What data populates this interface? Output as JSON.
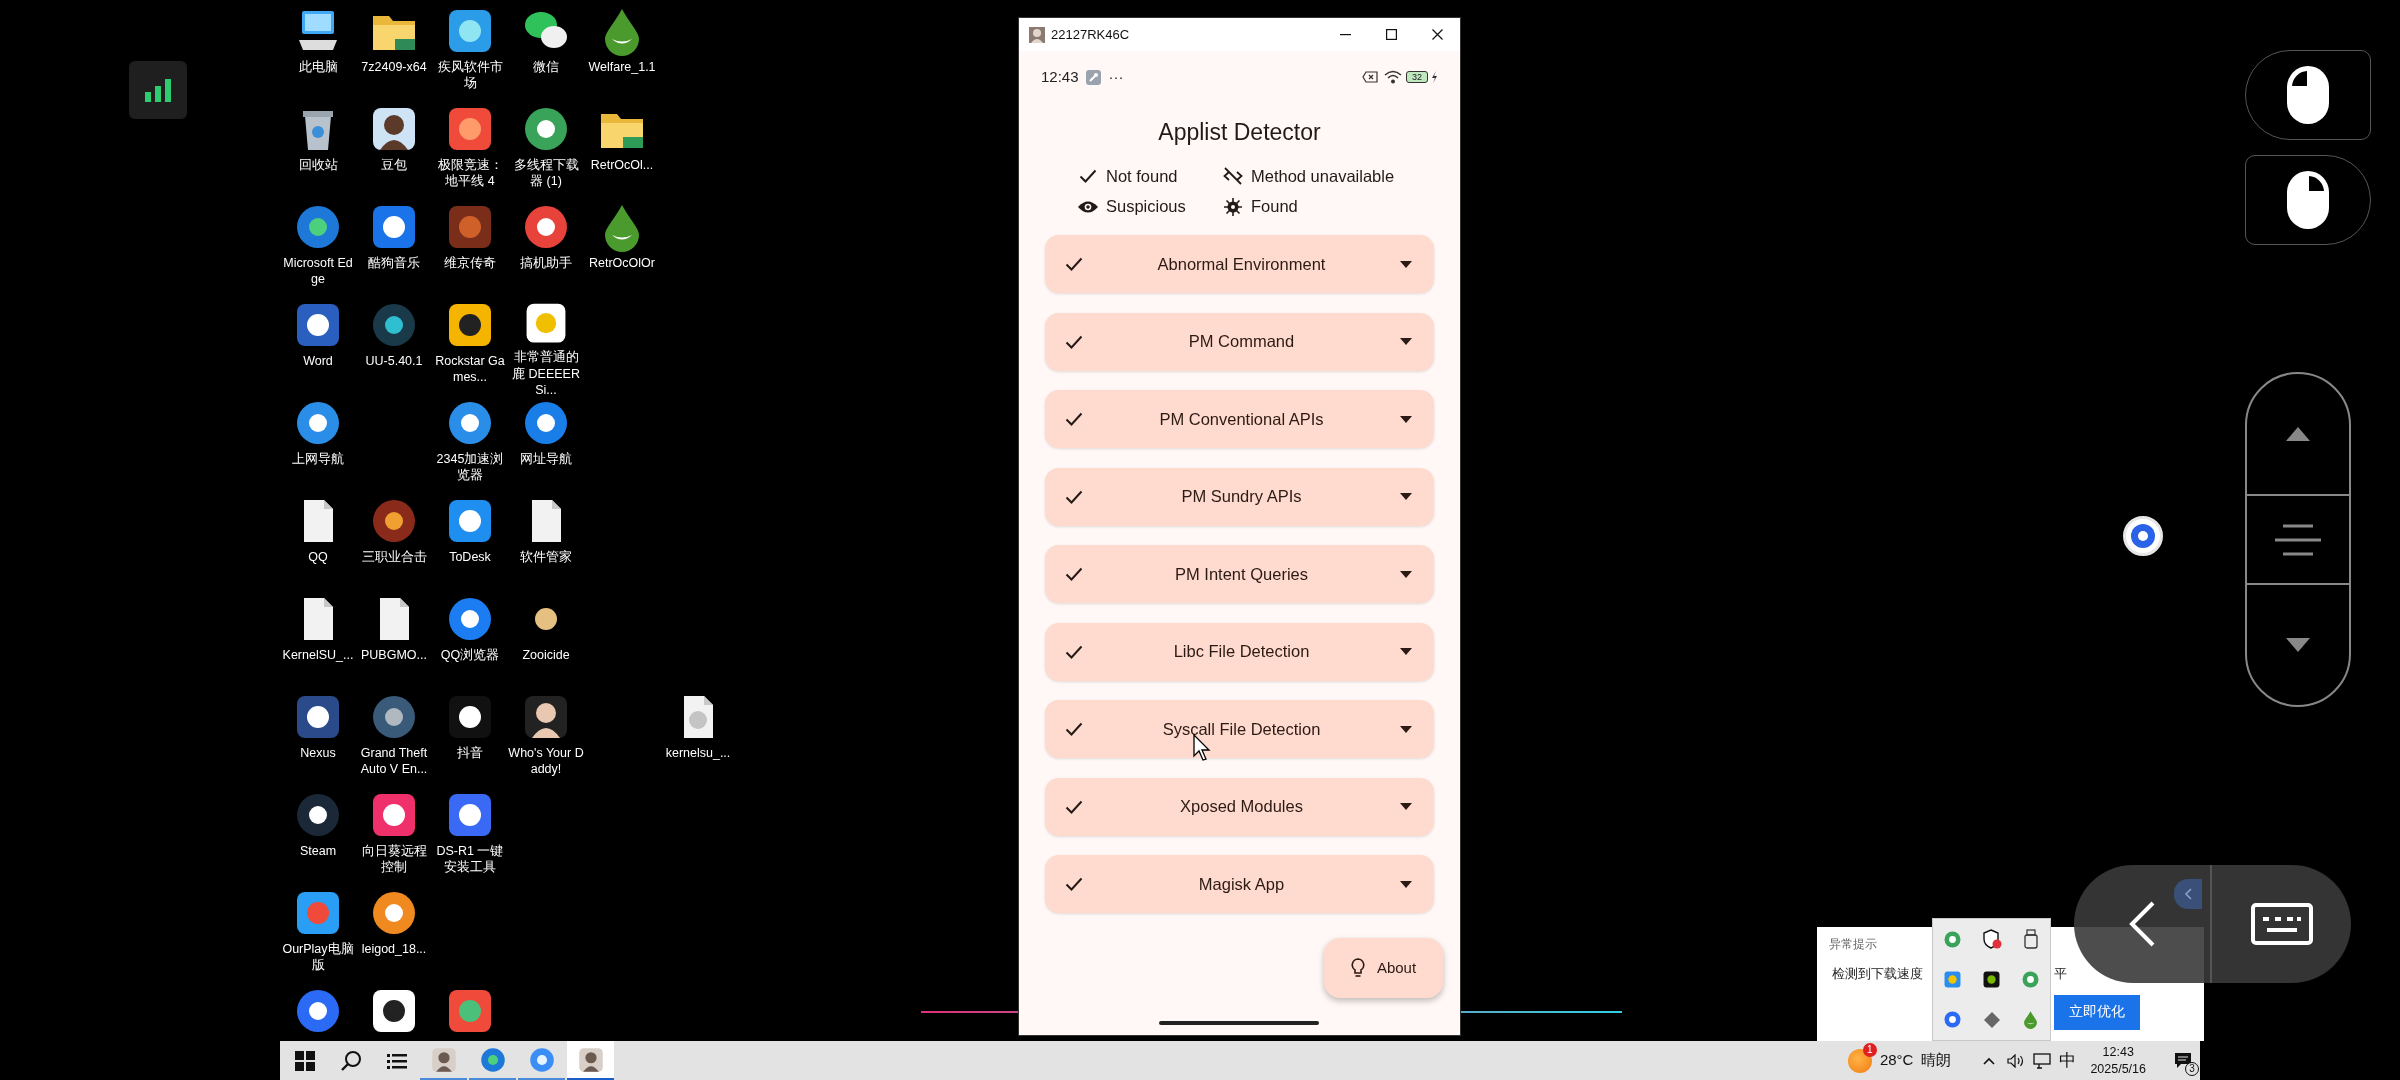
{
  "desktop_icons": [
    {
      "label": "此电脑"
    },
    {
      "label": "7z2409-x64"
    },
    {
      "label": "疾风软件市场"
    },
    {
      "label": "微信"
    },
    {
      "label": "Welfare_1.1"
    },
    {
      "label": "回收站"
    },
    {
      "label": "豆包"
    },
    {
      "label": "极限竞速：地平线 4"
    },
    {
      "label": "多线程下载器 (1)"
    },
    {
      "label": "RetrOcOl..."
    },
    {
      "label": "Microsoft Edge"
    },
    {
      "label": "酷狗音乐"
    },
    {
      "label": "维京传奇"
    },
    {
      "label": "搞机助手"
    },
    {
      "label": "RetrOcOlOr"
    },
    {
      "label": "Word"
    },
    {
      "label": "UU-5.40.1"
    },
    {
      "label": "Rockstar Games..."
    },
    {
      "label": "非常普通的鹿 DEEEER Si..."
    },
    {
      "label": "上网导航"
    },
    {
      "label": "2345加速浏览器"
    },
    {
      "label": "网址导航"
    },
    {
      "label": "QQ"
    },
    {
      "label": "三职业合击"
    },
    {
      "label": "ToDesk"
    },
    {
      "label": "软件管家"
    },
    {
      "label": "KernelSU_..."
    },
    {
      "label": "PUBGMO..."
    },
    {
      "label": "QQ浏览器"
    },
    {
      "label": "Zooicide"
    },
    {
      "label": "Nexus"
    },
    {
      "label": "Grand Theft Auto V En..."
    },
    {
      "label": "抖音"
    },
    {
      "label": "Who's Your Daddy!"
    },
    {
      "label": "kernelsu_..."
    },
    {
      "label": "Steam"
    },
    {
      "label": "向日葵远程控制"
    },
    {
      "label": "DS-R1 一键安装工具"
    },
    {
      "label": "OurPlay电脑版"
    },
    {
      "label": "leigod_18..."
    }
  ],
  "taskbar": {
    "apps": [
      {
        "selected": false
      },
      {
        "selected": false
      },
      {
        "selected": false
      },
      {
        "selected": true
      }
    ]
  },
  "tray": {
    "weather_badge": "1",
    "temperature": "28°C",
    "weather": "晴朗",
    "ime": "中",
    "time": "12:43",
    "date": "2025/5/16",
    "notification_count": "3"
  },
  "notification": {
    "title": "异常提示",
    "message_start": "检测到下载速度",
    "message_end": "平",
    "button": "立即优化"
  },
  "app_window": {
    "title": "22127RK46C",
    "status_bar": {
      "time": "12:43",
      "more": "···",
      "battery": "32"
    },
    "app_title": "Applist Detector",
    "legend": [
      {
        "kind": "not_found",
        "label": "Not found"
      },
      {
        "kind": "unavailable",
        "label": "Method unavailable"
      },
      {
        "kind": "suspicious",
        "label": "Suspicious"
      },
      {
        "kind": "found",
        "label": "Found"
      }
    ],
    "checks": [
      {
        "label": "Abnormal Environment",
        "kind": "not_found"
      },
      {
        "label": "PM Command",
        "kind": "not_found"
      },
      {
        "label": "PM Conventional APIs",
        "kind": "not_found"
      },
      {
        "label": "PM Sundry APIs",
        "kind": "not_found"
      },
      {
        "label": "PM Intent Queries",
        "kind": "not_found"
      },
      {
        "label": "Libc File Detection",
        "kind": "not_found"
      },
      {
        "label": "Syscall File Detection",
        "kind": "not_found"
      },
      {
        "label": "Xposed Modules",
        "kind": "not_found"
      },
      {
        "label": "Magisk App",
        "kind": "not_found"
      }
    ],
    "fab": {
      "label": "About"
    }
  }
}
